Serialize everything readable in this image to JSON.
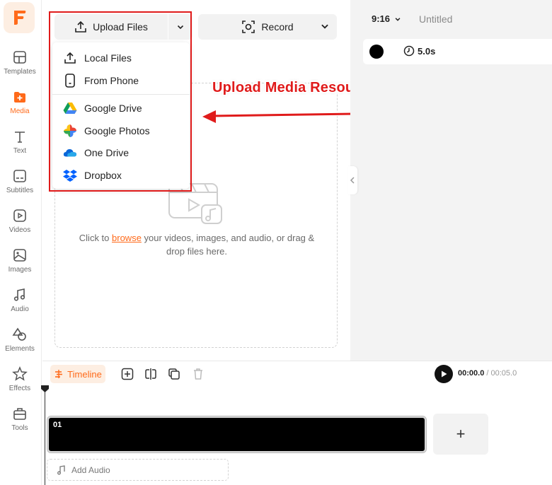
{
  "app": {
    "logo_letter": "F",
    "accent_color": "#ff6a1a",
    "annotation_color": "#e01b1b"
  },
  "sidebar": {
    "items": [
      {
        "label": "Templates",
        "icon": "templates-icon",
        "active": false
      },
      {
        "label": "Media",
        "icon": "media-icon",
        "active": true
      },
      {
        "label": "Text",
        "icon": "text-icon",
        "active": false
      },
      {
        "label": "Subtitles",
        "icon": "subtitles-icon",
        "active": false
      },
      {
        "label": "Videos",
        "icon": "videos-icon",
        "active": false
      },
      {
        "label": "Images",
        "icon": "images-icon",
        "active": false
      },
      {
        "label": "Audio",
        "icon": "audio-icon",
        "active": false
      },
      {
        "label": "Elements",
        "icon": "elements-icon",
        "active": false
      },
      {
        "label": "Effects",
        "icon": "effects-icon",
        "active": false
      },
      {
        "label": "Tools",
        "icon": "tools-icon",
        "active": false
      }
    ]
  },
  "toolbar": {
    "upload_label": "Upload Files",
    "record_label": "Record"
  },
  "upload_menu": {
    "items": [
      {
        "label": "Local Files",
        "icon": "upload-icon"
      },
      {
        "label": "From Phone",
        "icon": "phone-icon"
      },
      {
        "label": "Google Drive",
        "icon": "google-drive-icon"
      },
      {
        "label": "Google Photos",
        "icon": "google-photos-icon"
      },
      {
        "label": "One Drive",
        "icon": "onedrive-icon"
      },
      {
        "label": "Dropbox",
        "icon": "dropbox-icon"
      }
    ]
  },
  "dropzone": {
    "text_before": "Click to ",
    "link_text": "browse",
    "text_after": " your videos, images, and audio, or drag & drop files here."
  },
  "annotation": {
    "text": "Upload Media Resources"
  },
  "preview": {
    "aspect_ratio": "9:16",
    "project_title": "Untitled",
    "background_color": "#000000",
    "duration": "5.0s"
  },
  "timeline": {
    "tab_label": "Timeline",
    "current_time": "00:00.0",
    "separator": " / ",
    "total_time": "00:05.0",
    "clip_label": "01",
    "add_clip_label": "+",
    "add_audio_label": "Add Audio"
  }
}
